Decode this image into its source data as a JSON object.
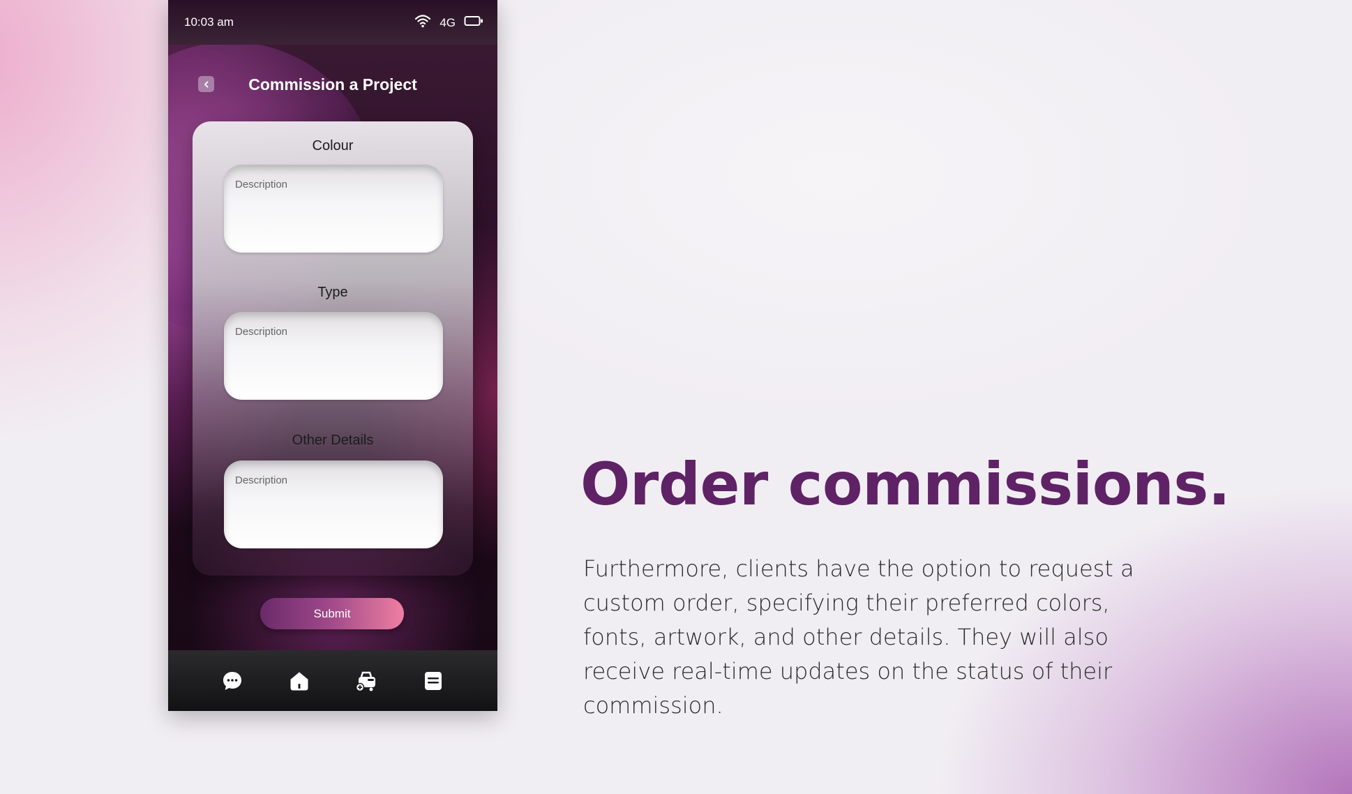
{
  "status_bar": {
    "time": "10:03 am",
    "network": "4G"
  },
  "header": {
    "title": "Commission a Project"
  },
  "form": {
    "fields": [
      {
        "label": "Colour",
        "placeholder": "Description"
      },
      {
        "label": "Type",
        "placeholder": "Description"
      },
      {
        "label": "Other Details",
        "placeholder": "Description"
      }
    ],
    "submit_label": "Submit"
  },
  "tab_bar": {
    "items": [
      {
        "icon": "chat-bubble-icon"
      },
      {
        "icon": "home-icon"
      },
      {
        "icon": "cart-add-icon"
      },
      {
        "icon": "orders-list-icon"
      }
    ]
  },
  "marketing": {
    "headline": "Order commissions.",
    "body": "Furthermore, clients have the option to request a custom order, specifying their preferred colors, fonts, artwork, and other details. They will also receive real-time updates on the status of their commission."
  },
  "colors": {
    "accent": "#5f2266",
    "button_start": "#6a2a6a",
    "button_end": "#ef7fa2"
  }
}
